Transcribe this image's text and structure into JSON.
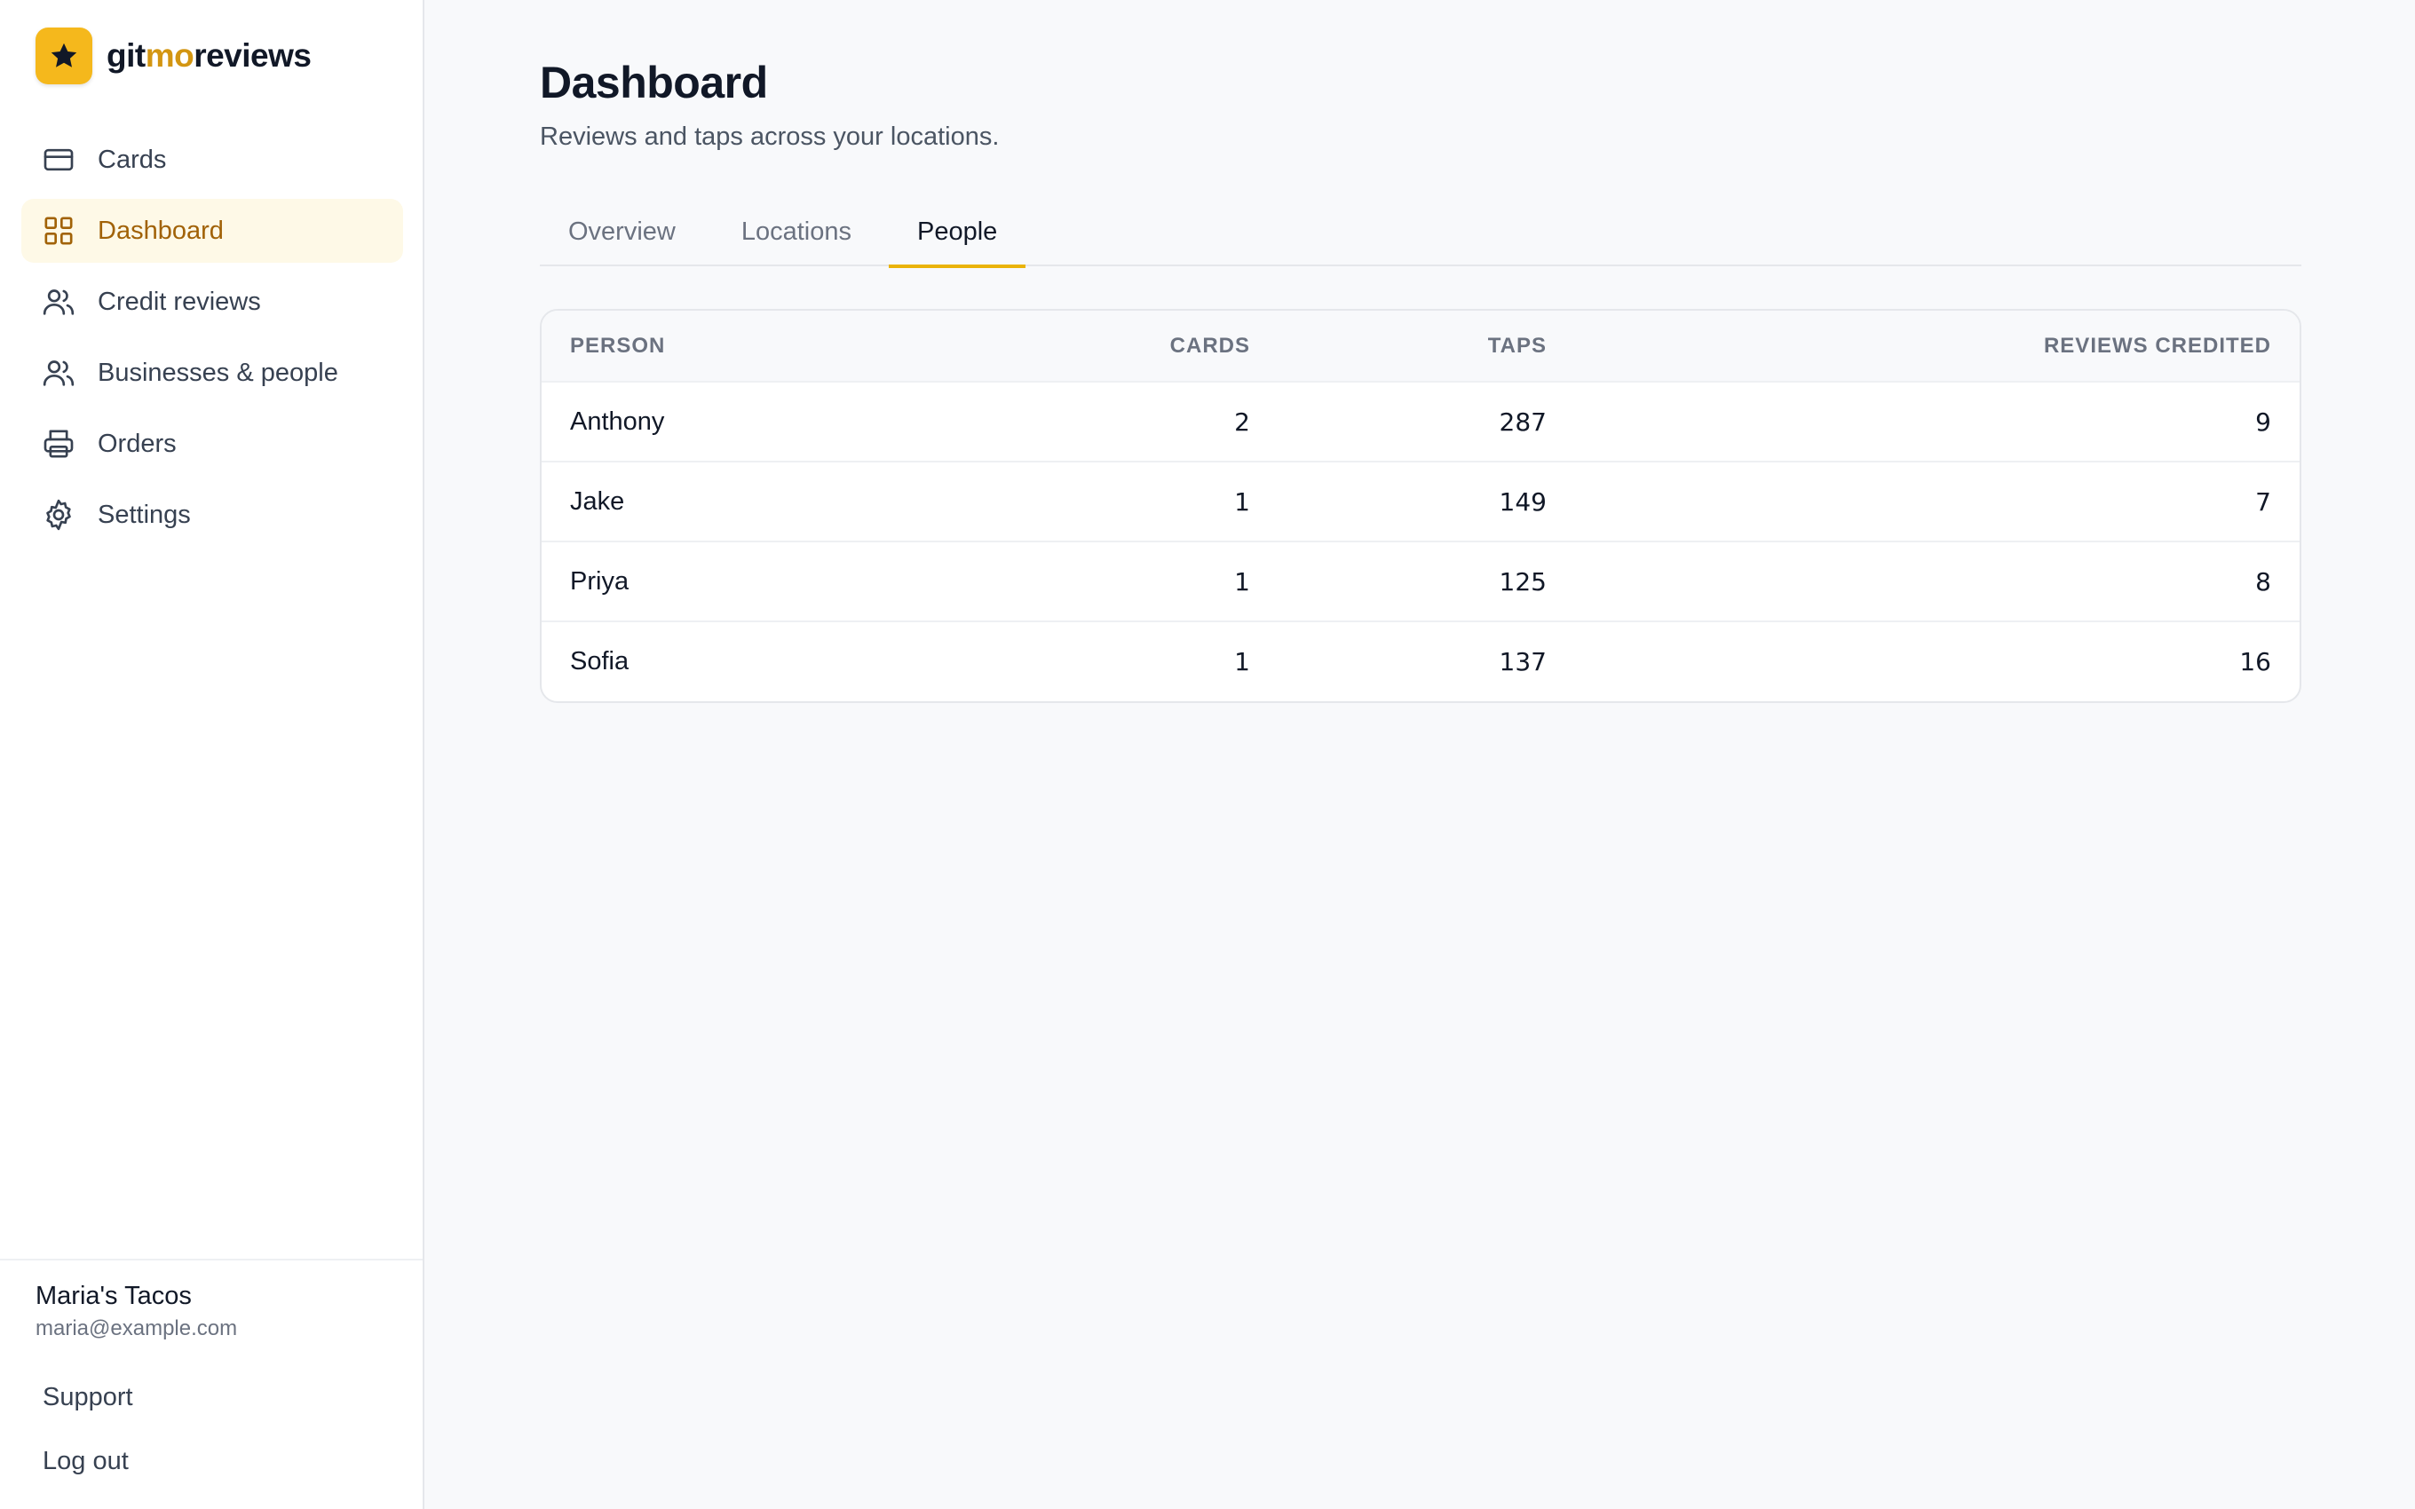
{
  "brand": {
    "name_part1": "git",
    "name_part2": "mo",
    "name_part3": "reviews",
    "logo_icon": "star-icon",
    "accent_color": "#f5b81c"
  },
  "sidebar": {
    "items": [
      {
        "label": "Cards",
        "icon": "credit-card-icon",
        "active": false
      },
      {
        "label": "Dashboard",
        "icon": "grid-icon",
        "active": true
      },
      {
        "label": "Credit reviews",
        "icon": "users-icon",
        "active": false
      },
      {
        "label": "Businesses & people",
        "icon": "users-icon",
        "active": false
      },
      {
        "label": "Orders",
        "icon": "printer-icon",
        "active": false
      },
      {
        "label": "Settings",
        "icon": "gear-icon",
        "active": false
      }
    ],
    "account": {
      "name": "Maria's Tacos",
      "email": "maria@example.com"
    },
    "support_label": "Support",
    "logout_label": "Log out"
  },
  "main": {
    "title": "Dashboard",
    "subtitle": "Reviews and taps across your locations.",
    "tabs": [
      {
        "label": "Overview",
        "active": false
      },
      {
        "label": "Locations",
        "active": false
      },
      {
        "label": "People",
        "active": true
      }
    ],
    "table": {
      "headers": {
        "person": "PERSON",
        "cards": "CARDS",
        "taps": "TAPS",
        "reviews": "REVIEWS CREDITED"
      },
      "rows": [
        {
          "person": "Anthony",
          "cards": "2",
          "taps": "287",
          "reviews": "9"
        },
        {
          "person": "Jake",
          "cards": "1",
          "taps": "149",
          "reviews": "7"
        },
        {
          "person": "Priya",
          "cards": "1",
          "taps": "125",
          "reviews": "8"
        },
        {
          "person": "Sofia",
          "cards": "1",
          "taps": "137",
          "reviews": "16"
        }
      ]
    }
  }
}
